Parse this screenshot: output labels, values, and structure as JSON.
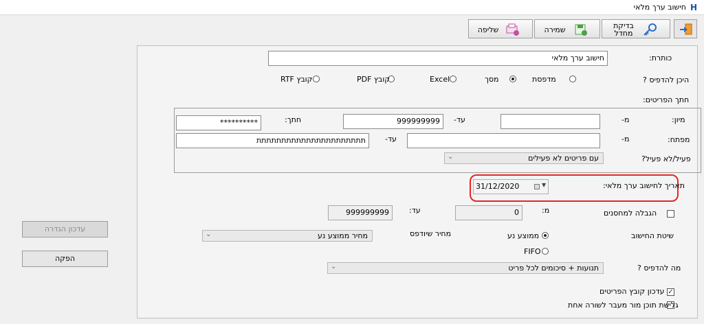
{
  "window": {
    "title": "חישוב ערך מלאי"
  },
  "toolbar": {
    "help_label": "בדיקת מחדל",
    "save_label": "שמירה",
    "print_label": "שליפה"
  },
  "form": {
    "subject_label": "כותרת:",
    "subject_value": "חישוב ערך מלאי",
    "where_label": "היכן להדפיס ?",
    "output_options": [
      "מדפסת",
      "מסך",
      "Excel",
      "קובץ PDF",
      "קובץ RTF"
    ],
    "output_selected": "מסך",
    "items_section_label": "חתך הפריטים:",
    "sort_label": "מיון:",
    "from_label": "מ-",
    "to_label": "עד-",
    "sort_from": "",
    "sort_to": "999999999",
    "cut_label": "חתך:",
    "cut_value": "**********",
    "key_label": "מפתח:",
    "key_from": "",
    "key_to": "תתתתתתתתתתתתתתתתתתתתתת",
    "active_label": "פעיל/לא פעיל?",
    "active_value": "עם פריטים לא פעילים",
    "date_label": "תאריך לחישוב ערך מלאי:",
    "date_value": "31/12/2020",
    "warehouse_limit_label": "הגבלה למחסנים",
    "wh_from_label": "מ:",
    "wh_from": "0",
    "wh_to_label": "עד:",
    "wh_to": "999999999",
    "calc_method_label": "שיטת החישוב",
    "calc_options": [
      "ממוצע נע",
      "FIFO"
    ],
    "calc_selected": "ממוצע נע",
    "price_label": "מחיר שיודפס",
    "price_value": "מחיר ממוצע נע",
    "what_print_label": "מה להדפיס ?",
    "what_print_value": "תנועות + סיכומים לכל פריט",
    "update_items_label": "עדכון קובץ הפריטים",
    "update_items_checked": true,
    "wrap_label": "גלישת תוכן מור מעבר לשורה אחת",
    "wrap_checked": false
  },
  "side": {
    "update_label": "עדכון הגדרה",
    "produce_label": "הפקה"
  }
}
